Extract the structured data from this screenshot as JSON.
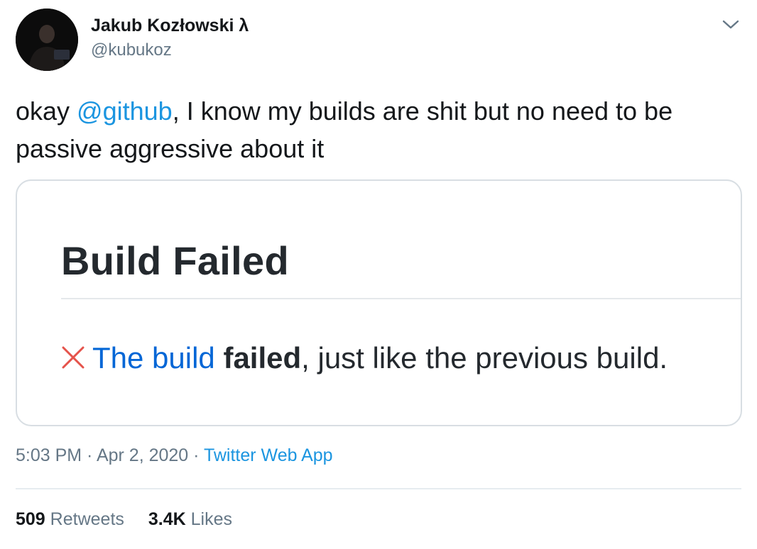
{
  "author": {
    "display_name": "Jakub Kozłowski λ",
    "handle": "@kubukoz"
  },
  "tweet": {
    "text_before": "okay ",
    "mention": "@github",
    "text_after": ", I know my builds are shit but no need to be passive aggressive about it"
  },
  "card": {
    "heading": "Build Failed",
    "link_text": "The build",
    "bold_text": "failed",
    "rest_text": ", just like the previous build.",
    "colors": {
      "fail_icon": "#e5534b",
      "link": "#0366d6"
    }
  },
  "meta": {
    "time": "5:03 PM",
    "sep1": " · ",
    "date": "Apr 2, 2020",
    "sep2": " · ",
    "source": "Twitter Web App"
  },
  "stats": {
    "retweets_count": "509",
    "retweets_label": "Retweets",
    "likes_count": "3.4K",
    "likes_label": "Likes"
  },
  "icons": {
    "menu": "chevron-down-icon",
    "fail": "x-icon"
  },
  "colors": {
    "primary_text": "#14171a",
    "secondary_text": "#657786",
    "accent": "#1b95e0"
  }
}
